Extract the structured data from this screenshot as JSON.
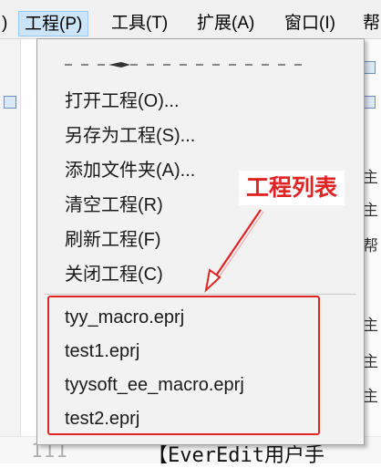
{
  "menubar": {
    "partial_left": ")",
    "items": [
      "工程(P)",
      "工具(T)",
      "扩展(A)",
      "窗口(I)",
      "帮"
    ]
  },
  "dropdown": {
    "actions": [
      "打开工程(O)...",
      "另存为工程(S)...",
      "添加文件夹(A)...",
      "清空工程(R)",
      "刷新工程(F)",
      "关闭工程(C)"
    ],
    "projects": [
      "tyy_macro.eprj",
      "test1.eprj",
      "tyysoft_ee_macro.eprj",
      "test2.eprj"
    ]
  },
  "annotation": {
    "label": "工程列表",
    "color": "#e02424"
  },
  "background": {
    "side_chars": [
      "主",
      "主",
      "帮",
      "主",
      "主",
      "主"
    ],
    "line_number": "111",
    "editor_text": "【EverEdit用户手"
  },
  "colors": {
    "menu_active_bg": "#cce4f7",
    "menu_active_border": "#99c9ef",
    "dropdown_bg": "#f2f2f2"
  }
}
